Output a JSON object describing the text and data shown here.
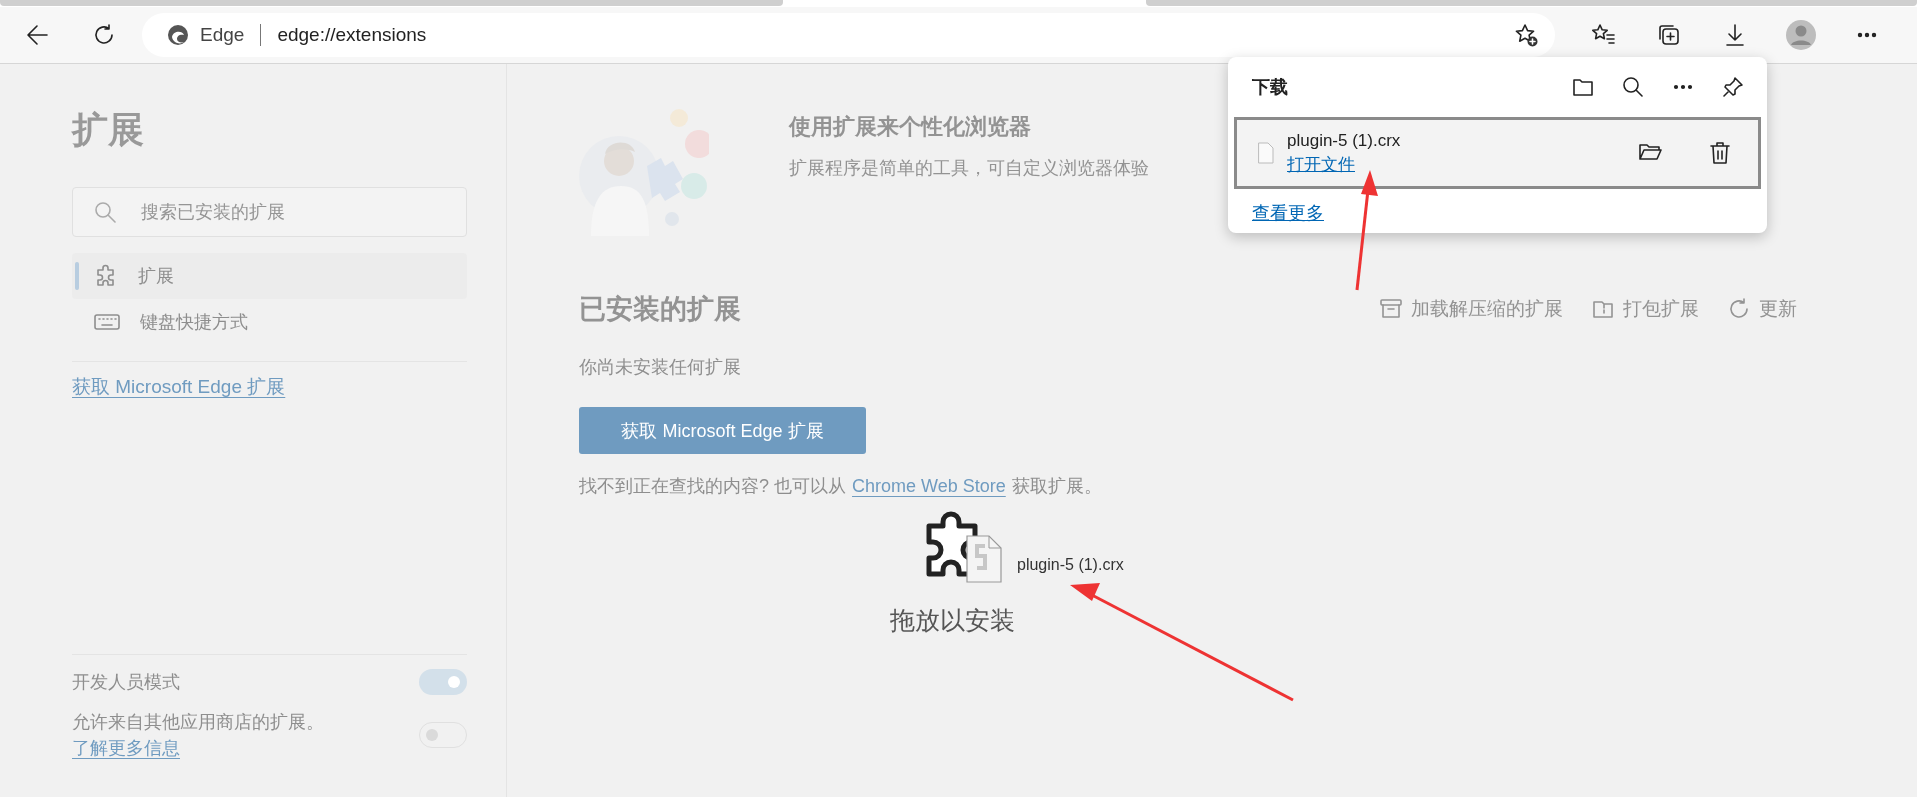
{
  "toolbar": {
    "site_label": "Edge",
    "url": "edge://extensions"
  },
  "sidebar": {
    "title": "扩展",
    "search": {
      "placeholder": "搜索已安装的扩展"
    },
    "items": [
      {
        "label": "扩展",
        "kind": "puzzle",
        "selected": true
      },
      {
        "label": "键盘快捷方式",
        "kind": "keyboard",
        "selected": false
      }
    ],
    "store_link": "获取 Microsoft Edge 扩展",
    "settings": [
      {
        "label": "开发人员模式",
        "on": true
      },
      {
        "label": "允许来自其他应用商店的扩展。",
        "link": "了解更多信息",
        "on": false
      }
    ]
  },
  "main": {
    "banner": {
      "title": "使用扩展来个性化浏览器",
      "description": "扩展程序是简单的工具，可自定义浏览器体验"
    },
    "installed": {
      "title": "已安装的扩展",
      "actions": [
        {
          "label": "加载解压缩的扩展",
          "kind": "load"
        },
        {
          "label": "打包扩展",
          "kind": "pack"
        },
        {
          "label": "更新",
          "kind": "update"
        }
      ],
      "empty": "你尚未安装任何扩展",
      "button": "获取 Microsoft Edge 扩展",
      "help": {
        "before": "找不到正在查找的内容? 也可以从",
        "link": "Chrome Web Store",
        "after": "获取扩展。"
      }
    }
  },
  "drop": {
    "file": "plugin-5 (1).crx",
    "label": "拖放以安装"
  },
  "downloads": {
    "title": "下载",
    "items": [
      {
        "name": "plugin-5 (1).crx",
        "action": "打开文件",
        "selected": true
      }
    ],
    "more": "查看更多"
  }
}
